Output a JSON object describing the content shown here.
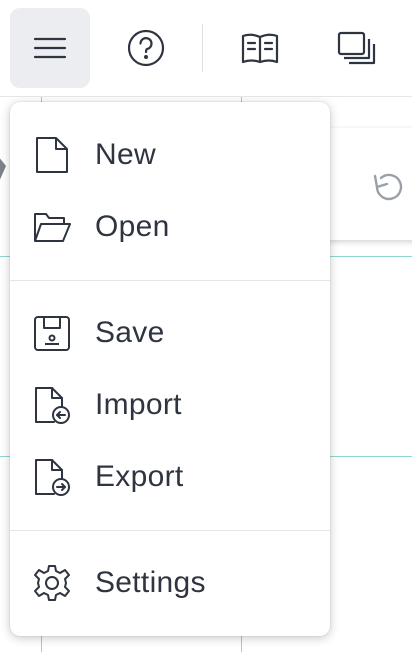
{
  "toolbar": {
    "buttons": [
      {
        "icon": "hamburger-menu-icon",
        "active": true
      },
      {
        "icon": "help-icon"
      },
      {
        "icon": "book-icon"
      },
      {
        "icon": "layers-icon"
      }
    ]
  },
  "menu": {
    "items": [
      {
        "label": "New",
        "icon": "file-icon"
      },
      {
        "label": "Open",
        "icon": "folder-open-icon"
      },
      {
        "label": "Save",
        "icon": "save-icon"
      },
      {
        "label": "Import",
        "icon": "import-icon"
      },
      {
        "label": "Export",
        "icon": "export-icon"
      },
      {
        "label": "Settings",
        "icon": "gear-icon"
      }
    ]
  },
  "colors": {
    "text": "#2f3540",
    "grid": "#8fd6d0",
    "active_button_bg": "#ecedf0"
  }
}
